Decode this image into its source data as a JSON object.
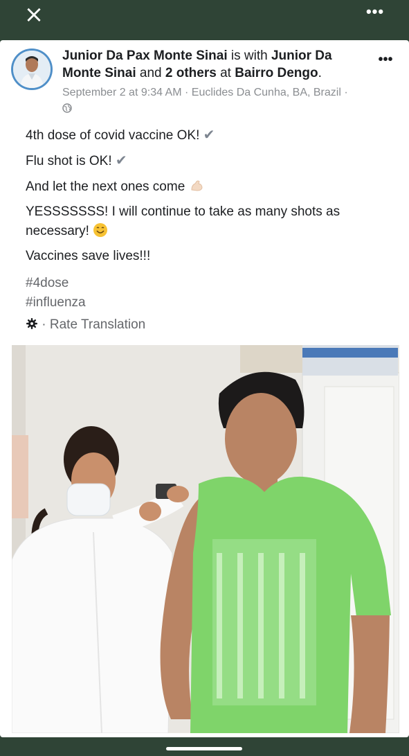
{
  "topbar": {
    "close_icon": "close-icon",
    "more_icon": "more-horizontal-icon"
  },
  "post": {
    "author": "Junior Da Pax Monte Sinai",
    "with_text": "is with",
    "tagged_user": "Junior Da Monte Sinai",
    "and_text": "and",
    "others": "2 others",
    "at_text": "at",
    "location_tag": "Bairro Dengo",
    "date": "September 2 at 9:34 AM",
    "place": "Euclides Da Cunha, BA, Brazil",
    "privacy_icon": "globe-icon",
    "lines": [
      "4th dose of covid vaccine OK!",
      "Flu shot is OK!",
      "And let the next ones come",
      "YESSSSSSS! I will continue to take as many shots as",
      "necessary!",
      "Vaccines save lives!!!"
    ],
    "hashtags": [
      "#4dose",
      "#influenza"
    ],
    "rate_translation": "Rate Translation"
  }
}
